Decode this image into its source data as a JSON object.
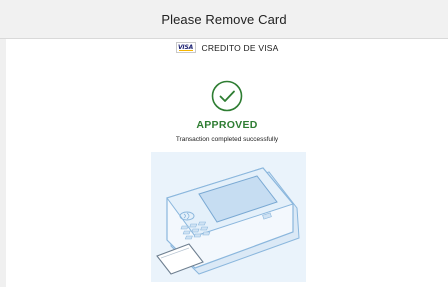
{
  "header": {
    "title": "Please Remove Card"
  },
  "payment": {
    "card_brand_logo_text": "VISA",
    "card_name": "CREDITO DE VISA"
  },
  "result": {
    "status": "APPROVED",
    "message": "Transaction completed successfully"
  },
  "icons": {
    "status": "check-circle-icon",
    "illustration": "card-terminal-remove-card"
  },
  "colors": {
    "success": "#2e7d32",
    "visa_blue": "#1a1f71",
    "visa_gold": "#f7b600",
    "illustration_blue": "#8bb7dd",
    "illustration_bg": "#eaf3fb"
  }
}
